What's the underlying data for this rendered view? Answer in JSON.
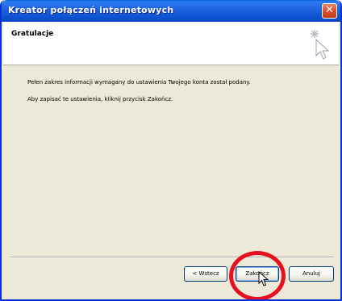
{
  "window": {
    "title": "Kreator połączeń internetowych",
    "close_label": "✕"
  },
  "header": {
    "title": "Gratulacje",
    "icon": "wizard-wand-icon"
  },
  "body": {
    "line1": "Pełen zakres informacji wymagany do ustawienia Twojego konta został podany.",
    "line2": "Aby zapisać te ustawienia, kliknij przycisk Zakończ."
  },
  "buttons": {
    "back": "< Wstecz",
    "finish": "Zakończ",
    "cancel": "Anuluj"
  },
  "annotation": {
    "highlight_color": "#e8101e"
  },
  "colors": {
    "titlebar": "#0a5fd8",
    "dialog_bg": "#ece9d8",
    "close": "#d9512a"
  }
}
